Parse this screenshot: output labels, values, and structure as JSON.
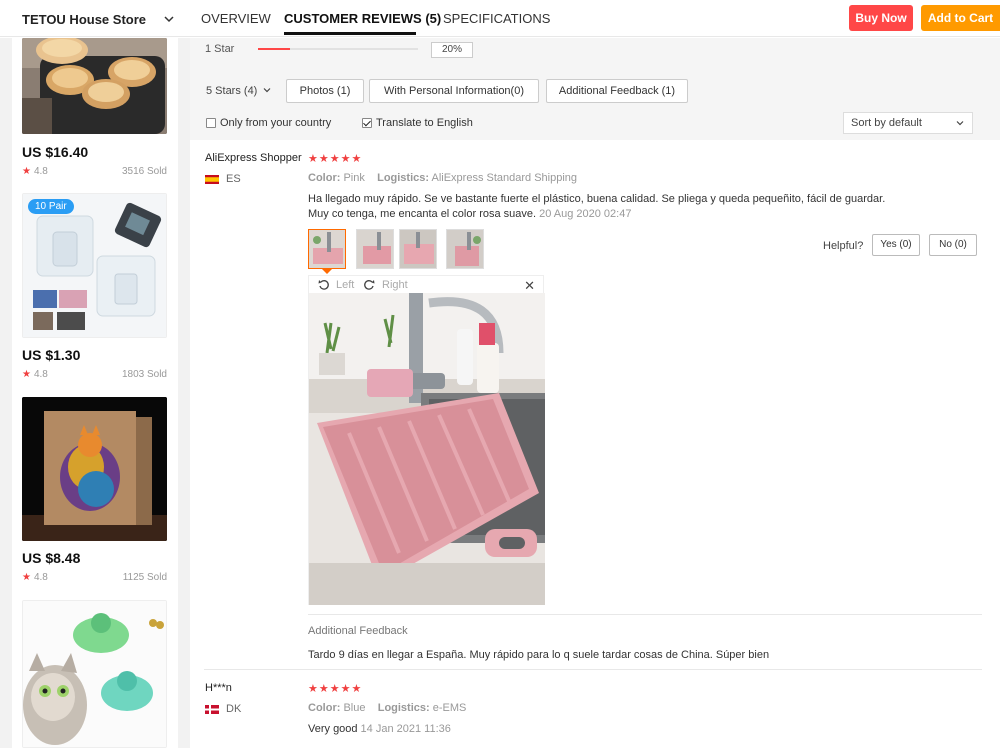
{
  "header": {
    "store_name": "TETOU House Store",
    "tabs": [
      {
        "label": "OVERVIEW"
      },
      {
        "label": "CUSTOMER REVIEWS (5)"
      },
      {
        "label": "SPECIFICATIONS"
      }
    ],
    "buy_now": "Buy Now",
    "add_to_cart": "Add to Cart"
  },
  "sidebar": {
    "products": [
      {
        "price": "US $16.40",
        "rating": "4.8",
        "sold": "3516 Sold"
      },
      {
        "price": "US $1.30",
        "rating": "4.8",
        "sold": "1803 Sold",
        "badge": "10 Pair"
      },
      {
        "price": "US $8.48",
        "rating": "4.8",
        "sold": "1125 Sold"
      },
      {
        "price": "",
        "rating": "",
        "sold": ""
      }
    ]
  },
  "rating_breakdown": {
    "label": "1 Star",
    "fill_fraction": 0.2,
    "percent_text": "20%"
  },
  "filters": {
    "stars_select": "5 Stars (4)",
    "buttons": [
      "Photos (1)",
      "With Personal Information(0)",
      "Additional Feedback (1)"
    ],
    "only_country": {
      "label": "Only from your country",
      "checked": false
    },
    "translate": {
      "label": "Translate to English",
      "checked": true
    },
    "sort": "Sort by default"
  },
  "reviews": [
    {
      "name": "AliExpress Shopper",
      "stars": "★★★★★",
      "country": "ES",
      "color_label": "Color:",
      "color": "Pink",
      "logistics_label": "Logistics:",
      "logistics": "AliExpress Standard Shipping",
      "text_line1": "Ha llegado muy rápido. Se ve bastante fuerte el plástico, buena calidad. Se pliega y queda pequeñito, fácil de guardar.",
      "text_line2": "Muy co tenga, me encanta el color rosa suave.",
      "date": "20 Aug 2020 02:47",
      "helpful": "Helpful?",
      "yes": "Yes (0)",
      "no": "No (0)",
      "viewer_left": "Left",
      "viewer_right": "Right",
      "additional_title": "Additional Feedback",
      "additional_text": "Tardo 9 días en llegar a España. Muy rápido para lo q suele tardar cosas de China. Súper bien"
    },
    {
      "name": "H***n",
      "stars": "★★★★★",
      "country": "DK",
      "color_label": "Color:",
      "color": "Blue",
      "logistics_label": "Logistics:",
      "logistics": "e-EMS",
      "text_line1": "Very good",
      "date": "14 Jan 2021 11:36"
    }
  ],
  "colors": {
    "accent_red": "#ff4747",
    "accent_orange": "#ff9a00",
    "star_red": "#f04040"
  }
}
